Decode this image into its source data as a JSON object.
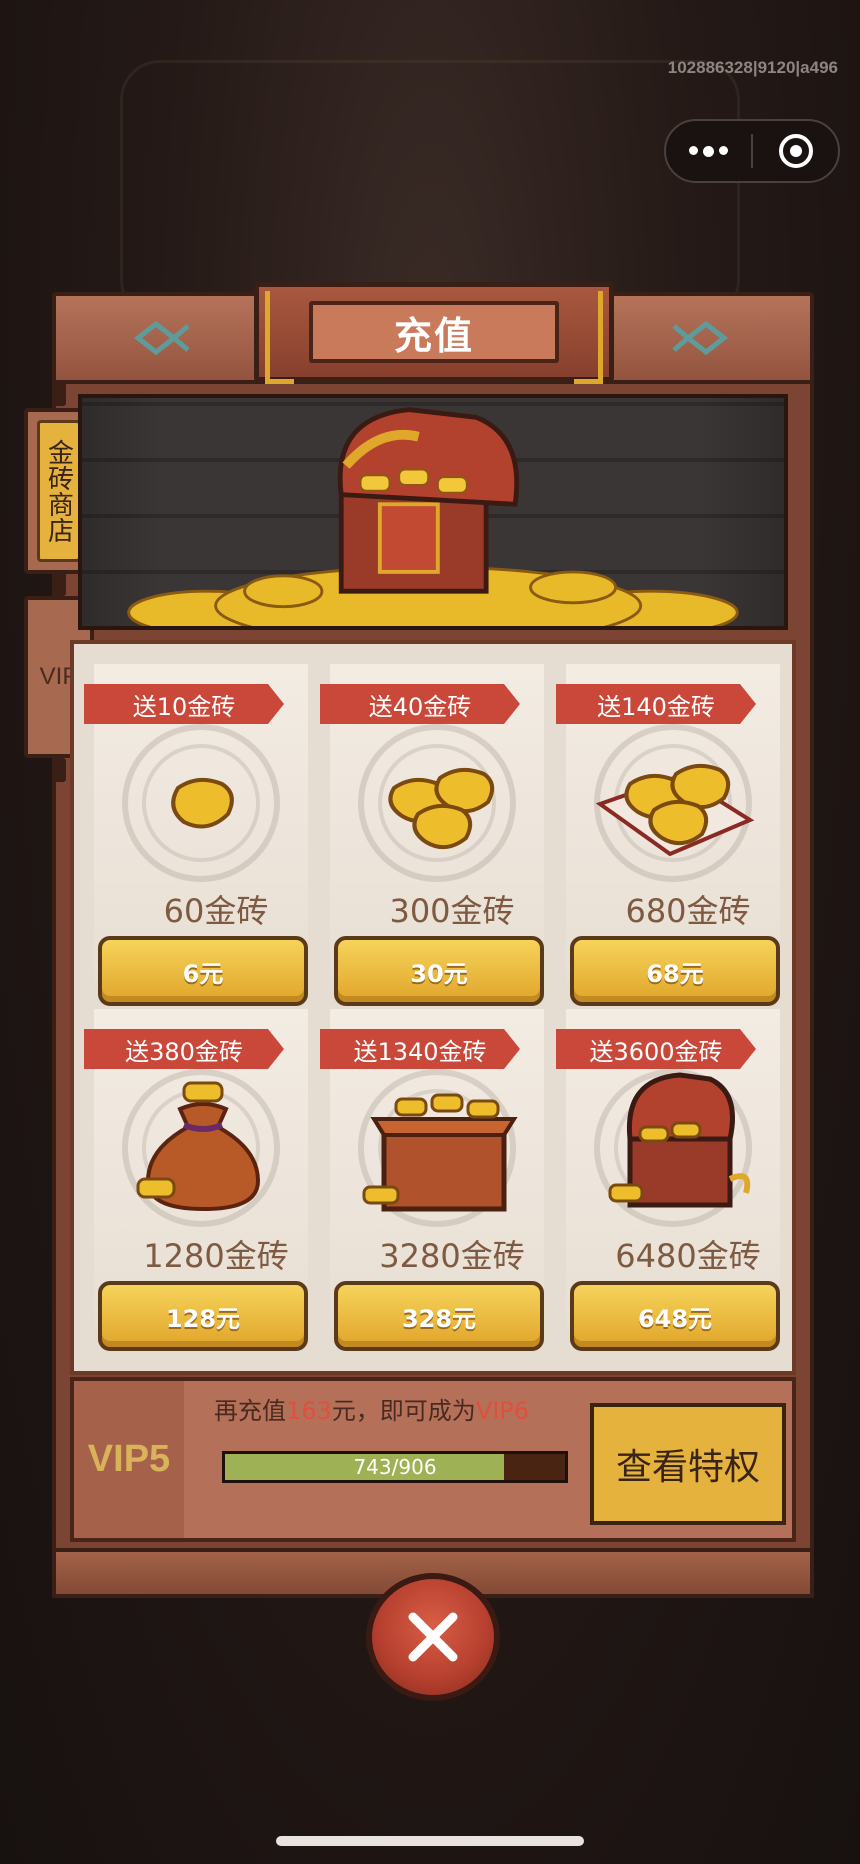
{
  "session_id": "102886328|9120|a496",
  "title": "充值",
  "side_tabs": {
    "shop": "金砖商店",
    "vip": "VIP"
  },
  "products": [
    {
      "bonus": "送10金砖",
      "amount": "60金砖",
      "price": "6元",
      "art": "single-gold-brick-icon"
    },
    {
      "bonus": "送40金砖",
      "amount": "300金砖",
      "price": "30元",
      "art": "gold-brick-pile-icon"
    },
    {
      "bonus": "送140金砖",
      "amount": "680金砖",
      "price": "68元",
      "art": "gold-brick-tray-icon"
    },
    {
      "bonus": "送380金砖",
      "amount": "1280金砖",
      "price": "128元",
      "art": "gold-money-bag-icon"
    },
    {
      "bonus": "送1340金砖",
      "amount": "3280金砖",
      "price": "328元",
      "art": "gold-crate-icon"
    },
    {
      "bonus": "送3600金砖",
      "amount": "6480金砖",
      "price": "648元",
      "art": "treasure-chest-icon"
    }
  ],
  "vip": {
    "level": "VIP5",
    "hint_prefix": "再充值",
    "hint_amount": "163",
    "hint_middle": "元，即可成为",
    "hint_next": "VIP6",
    "progress_text": "743/906",
    "progress_fraction": 0.82,
    "privilege_button": "查看特权"
  },
  "colors": {
    "ribbon": "#c9483a",
    "gold_button": "#e0a52a",
    "progress_fill": "#9fb155",
    "highlight": "#e0503c"
  }
}
